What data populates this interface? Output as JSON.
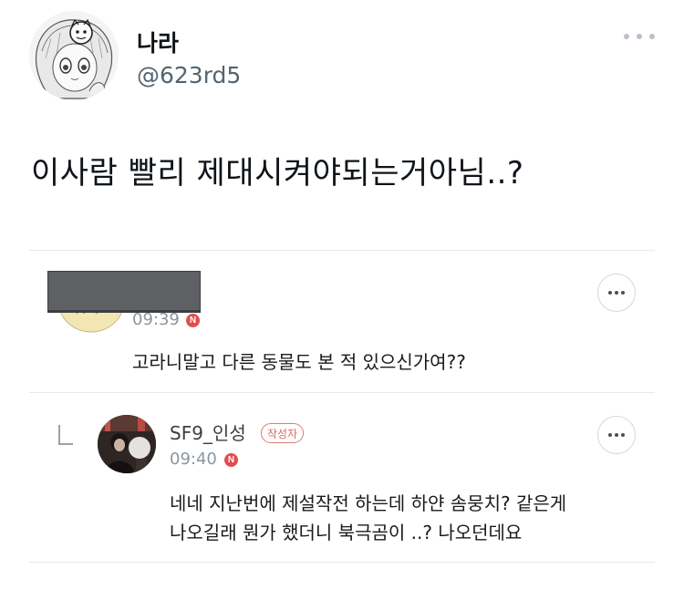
{
  "post": {
    "author": {
      "display_name": "나라",
      "handle": "@623rd5"
    },
    "text": "이사람 빨리 제대시켜야되는거아님..?"
  },
  "comment": {
    "time": "09:39",
    "new_badge": "N",
    "text": "고라니말고 다른 동물도 본 적 있으신가여??"
  },
  "reply": {
    "name": "SF9_인성",
    "author_badge": "작성자",
    "time": "09:40",
    "new_badge": "N",
    "text_line1": "네네 지난번에 제설작전 하는데 하얀 솜뭉치? 같은게",
    "text_line2": "나오길래 뭔가 했더니 북극곰이 ..? 나오던데요"
  },
  "icons": {
    "more": "more-horizontal-icon",
    "reply": "reply-corner-icon"
  },
  "colors": {
    "new_badge": "#e34c4c",
    "author_badge": "#e06666",
    "redaction": "#5f6063"
  }
}
